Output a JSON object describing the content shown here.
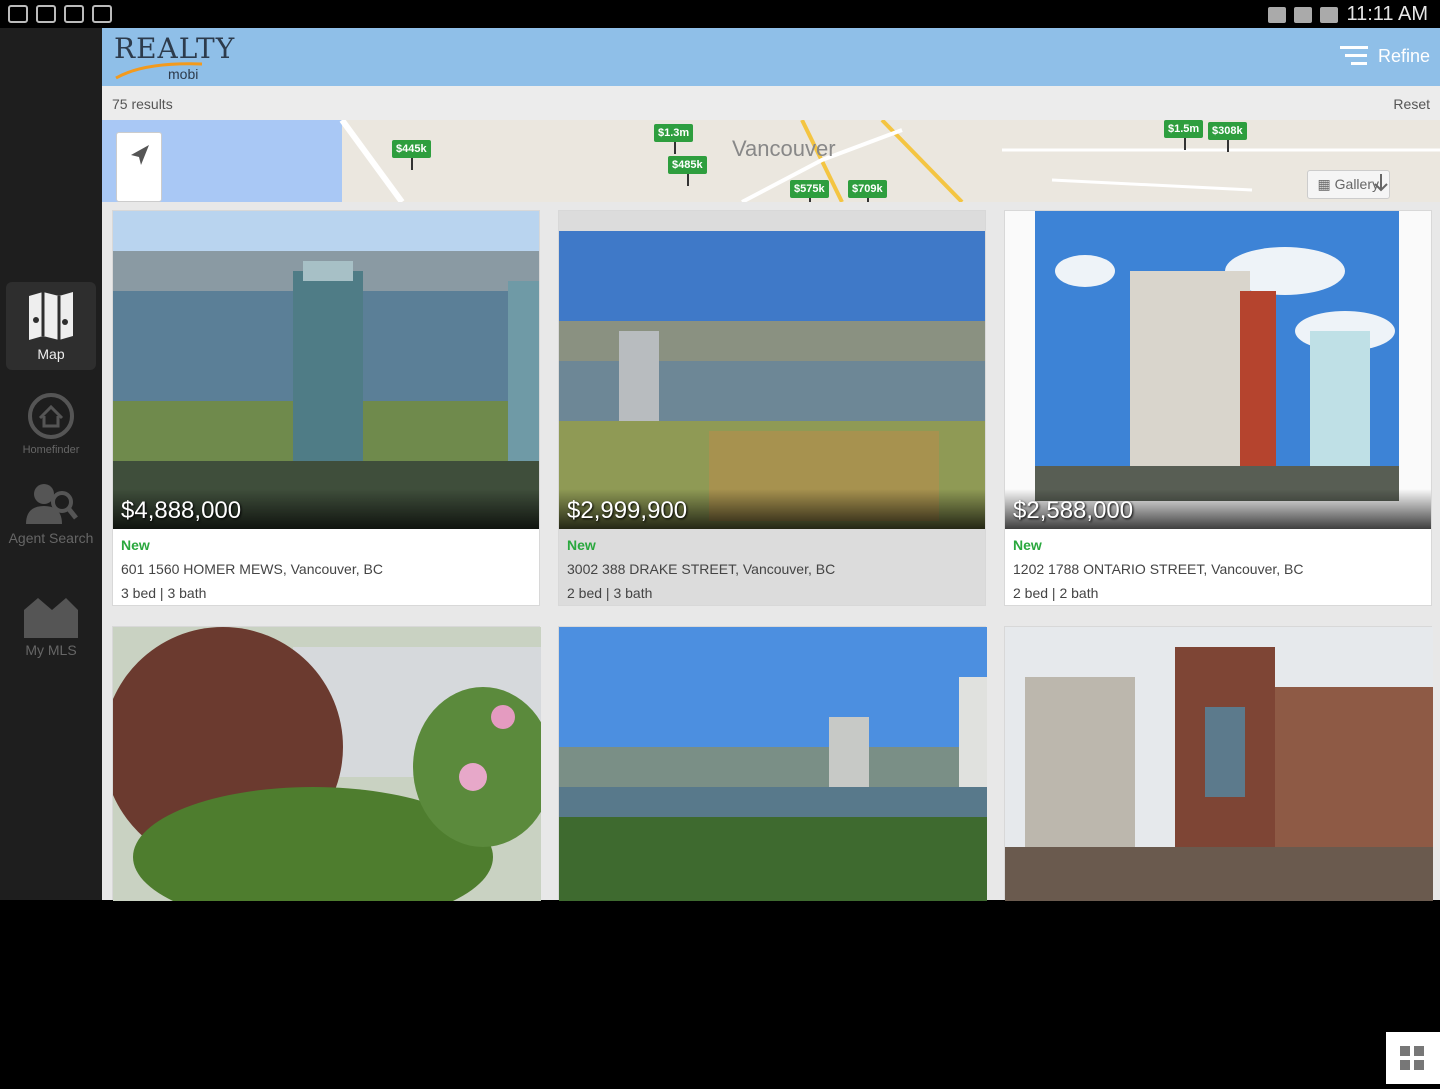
{
  "status_bar": {
    "time": "11:11 AM"
  },
  "sidebar": {
    "items": [
      {
        "label": "Map"
      },
      {
        "label": "Homefinder"
      },
      {
        "label": "Agent Search"
      },
      {
        "label": "My MLS"
      }
    ]
  },
  "app_bar": {
    "logo_text": "REALTY",
    "logo_sub": "mobi",
    "refine_label": "Refine"
  },
  "results_bar": {
    "count_text": "75 results",
    "reset_label": "Reset"
  },
  "map": {
    "city_label": "Vancouver",
    "gallery_label": "Gallery",
    "pins": [
      "$445k",
      "$1.3m",
      "$485k",
      "$575k",
      "$709k",
      "$1.5m",
      "$308k"
    ]
  },
  "listings": [
    {
      "price": "$4,888,000",
      "badge": "New",
      "address": "601 1560 HOMER MEWS, Vancouver, BC",
      "beds": "3 bed | 3 bath"
    },
    {
      "price": "$2,999,900",
      "badge": "New",
      "address": "3002 388 DRAKE STREET, Vancouver, BC",
      "beds": "2 bed | 3 bath"
    },
    {
      "price": "$2,588,000",
      "badge": "New",
      "address": "1202 1788 ONTARIO STREET, Vancouver, BC",
      "beds": "2 bed | 2 bath"
    }
  ],
  "colors": {
    "accent_green": "#2aa83e",
    "app_bar": "#8fbfe8",
    "sidebar": "#1e1e1e"
  }
}
